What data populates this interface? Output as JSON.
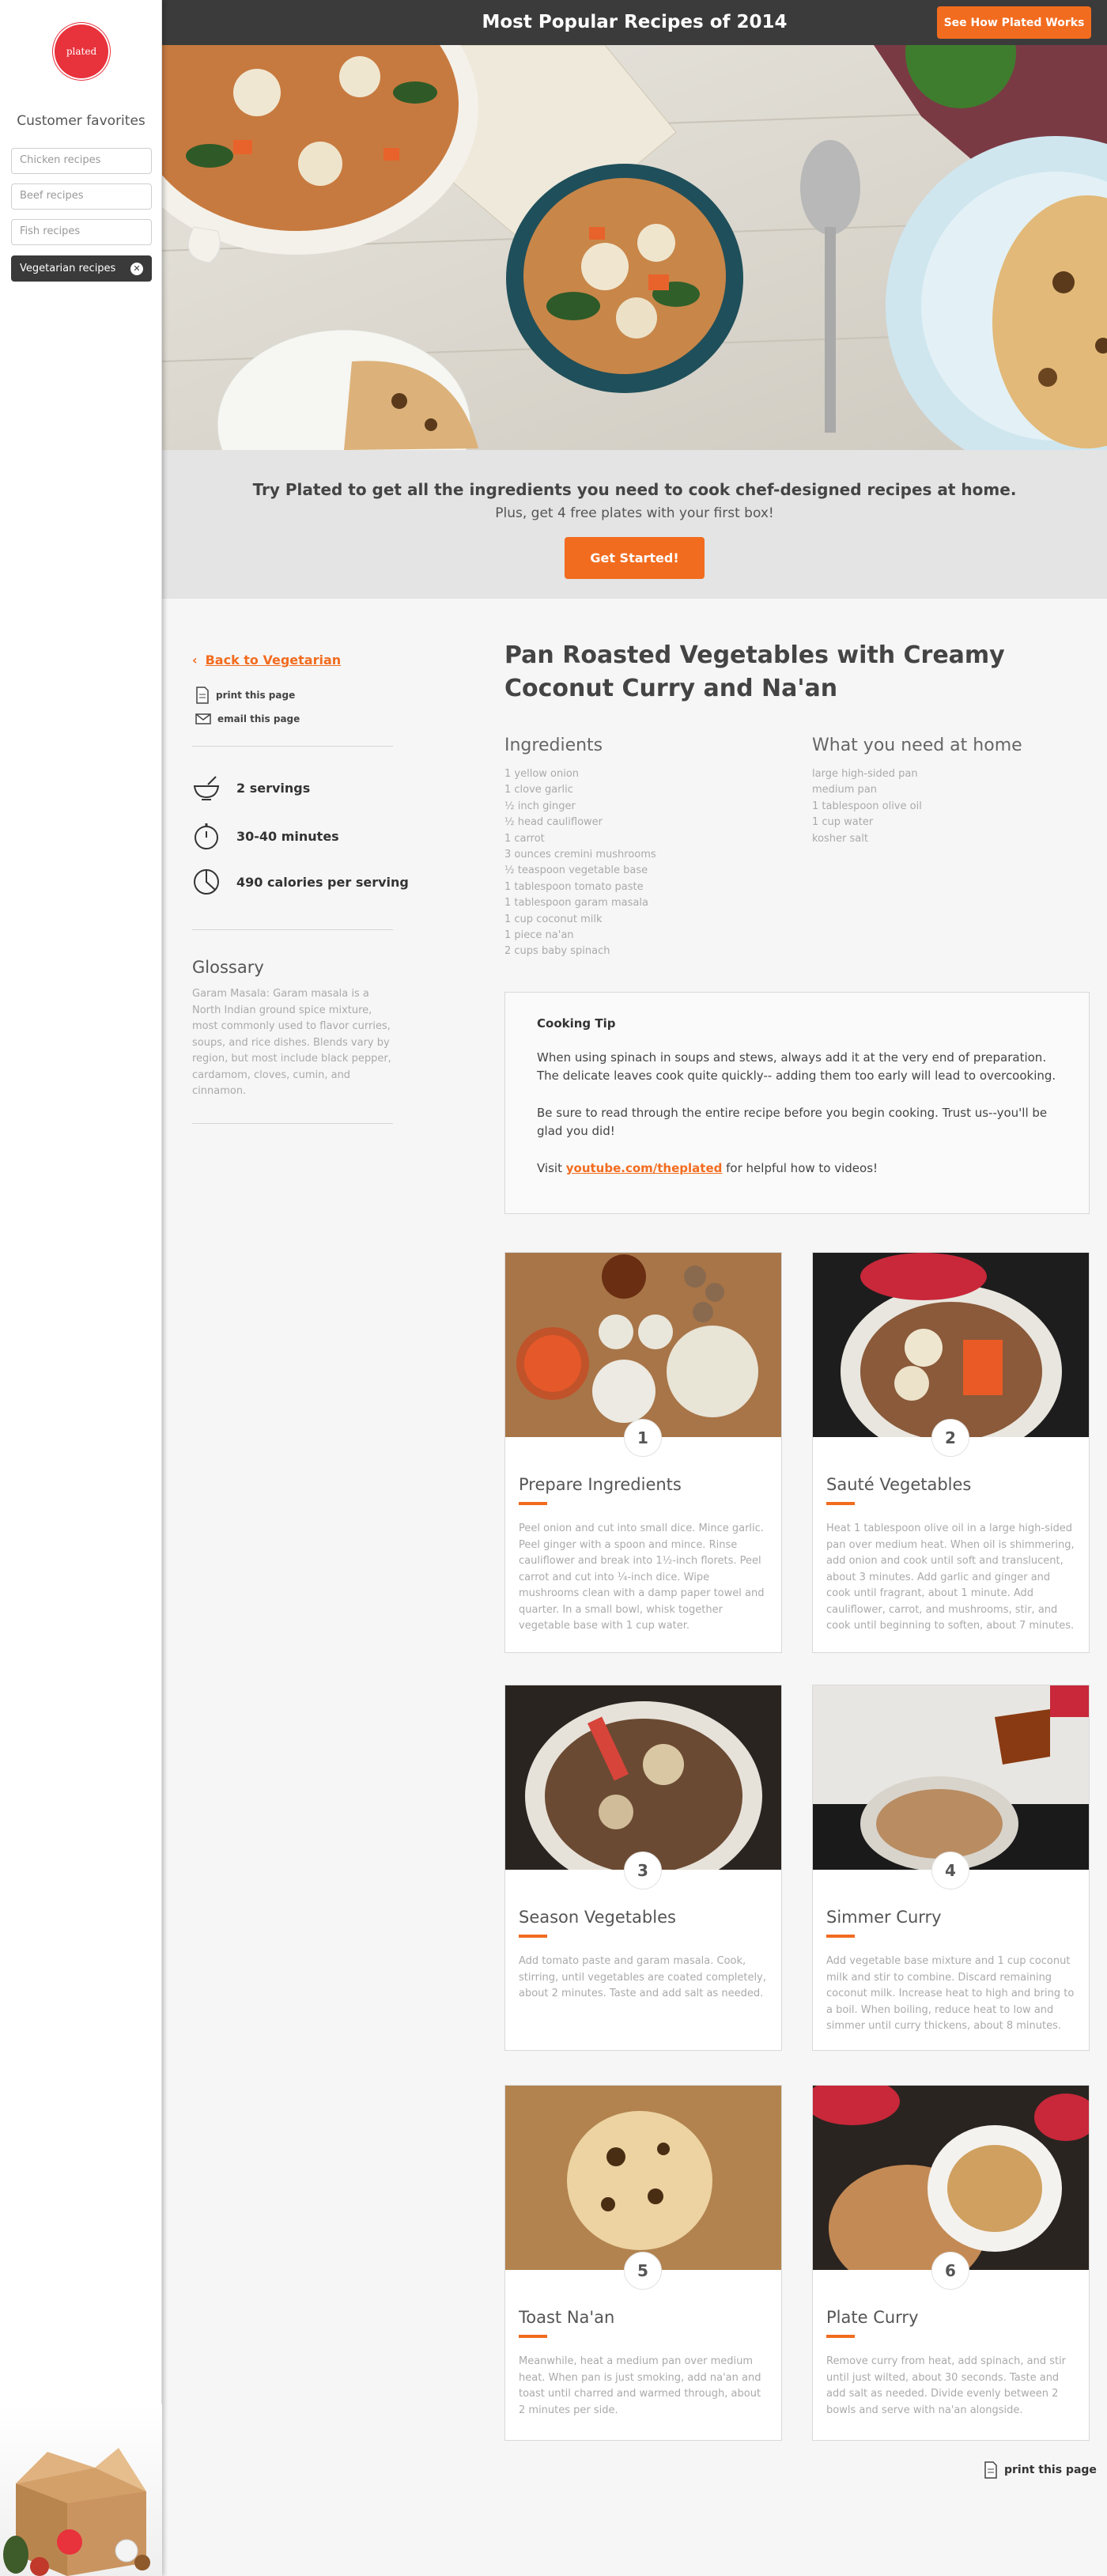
{
  "brand": {
    "logo_text": "plated",
    "accent": "#f26c1f",
    "logo_red": "#e8323c"
  },
  "sidebar": {
    "heading": "Customer favorites",
    "filters": [
      {
        "label": "Chicken recipes",
        "active": false
      },
      {
        "label": "Beef recipes",
        "active": false
      },
      {
        "label": "Fish recipes",
        "active": false
      },
      {
        "label": "Vegetarian recipes",
        "active": true,
        "clear_icon": "close-icon"
      }
    ]
  },
  "topbar": {
    "title": "Most Popular Recipes of 2014",
    "cta": "See How Plated Works"
  },
  "promo": {
    "title": "Try Plated to get all the ingredients you need to cook chef-designed recipes at home.",
    "subtitle": "Plus, get 4 free plates with your first box!",
    "button": "Get Started!"
  },
  "left": {
    "back": "Back to Vegetarian",
    "print": "print this page",
    "email": "email this page",
    "servings": "2 servings",
    "time": "30-40 minutes",
    "calories": "490 calories per serving",
    "glossary_title": "Glossary",
    "glossary_text": "Garam Masala: Garam masala is a North Indian ground spice mixture, most commonly used to flavor curries, soups, and rice dishes. Blends vary by region, but most include black pepper, cardamom, cloves, cumin, and cinnamon."
  },
  "recipe": {
    "title": "Pan Roasted Vegetables with Creamy Coconut Curry and Na'an",
    "ingredients_title": "Ingredients",
    "ingredients": [
      "1 yellow onion",
      "1 clove garlic",
      "½ inch ginger",
      "½ head cauliflower",
      "1 carrot",
      "3 ounces cremini mushrooms",
      "½ teaspoon vegetable base",
      "1 tablespoon tomato paste",
      "1 tablespoon garam masala",
      "1 cup coconut milk",
      "1 piece na'an",
      "2 cups baby spinach"
    ],
    "home_title": "What you need at home",
    "home": [
      "large high-sided pan",
      "medium pan",
      "1 tablespoon olive oil",
      "1 cup water",
      "kosher salt"
    ]
  },
  "tip": {
    "title": "Cooking Tip",
    "p1": "When using spinach in soups and stews, always add it at the very end of preparation. The delicate leaves cook quite quickly-- adding them too early will lead to overcooking.",
    "p2": "Be sure to read through the entire recipe before you begin cooking. Trust us--you'll be glad you did!",
    "p3_before": "Visit ",
    "link": "youtube.com/theplated",
    "p3_after": " for helpful how to videos!"
  },
  "steps": [
    {
      "num": "1",
      "title": "Prepare Ingredients",
      "text": "Peel onion and cut into small dice. Mince garlic. Peel ginger with a spoon and mince. Rinse cauliflower and break into 1½-inch florets. Peel carrot and cut into ¼-inch dice. Wipe mushrooms clean with a damp paper towel and quarter. In a small bowl, whisk together vegetable base with 1 cup water."
    },
    {
      "num": "2",
      "title": "Sauté Vegetables",
      "text": "Heat 1 tablespoon olive oil in a large high-sided pan over medium heat. When oil is shimmering, add onion and cook until soft and translucent, about 3 minutes. Add garlic and ginger and cook until fragrant, about 1 minute. Add cauliflower, carrot, and mushrooms, stir, and cook until beginning to soften, about 7 minutes."
    },
    {
      "num": "3",
      "title": "Season Vegetables",
      "text": "Add tomato paste and garam masala. Cook, stirring, until vegetables are coated completely, about 2 minutes. Taste and add salt as needed."
    },
    {
      "num": "4",
      "title": "Simmer Curry",
      "text": "Add vegetable base mixture and 1 cup coconut milk and stir to combine. Discard remaining coconut milk. Increase heat to high and bring to a boil. When boiling, reduce heat to low and simmer until curry thickens, about 8 minutes."
    },
    {
      "num": "5",
      "title": "Toast Na'an",
      "text": "Meanwhile, heat a medium pan over medium heat. When pan is just smoking, add na'an and toast until charred and warmed through, about 2 minutes per side."
    },
    {
      "num": "6",
      "title": "Plate Curry",
      "text": "Remove curry from heat, add spinach, and stir until just wilted, about 30 seconds. Taste and add salt as needed. Divide evenly between 2 bowls and serve with na'an alongside."
    }
  ],
  "footer": {
    "print": "print this page"
  }
}
